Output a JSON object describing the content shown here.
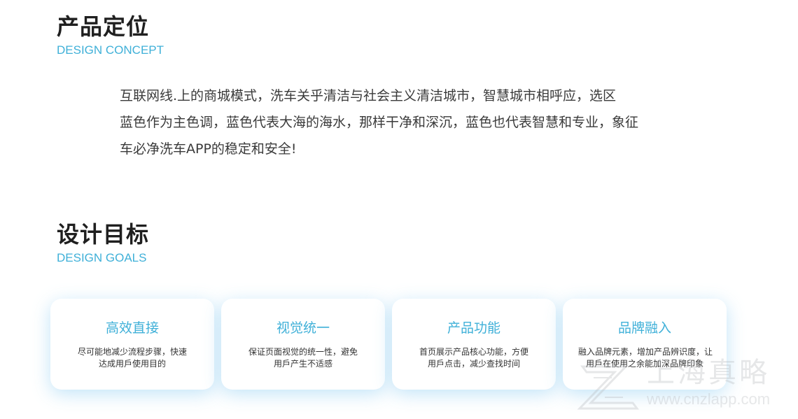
{
  "concept": {
    "title": "产品定位",
    "subtitle": "DESIGN CONCEPT",
    "lines": [
      "互联网线.上的商城模式，洗车关乎清洁与社会主义清洁城市，智慧城市相呼应，选区",
      "蓝色作为主色调，蓝色代表大海的海水，那样干净和深沉，蓝色也代表智慧和专业，象征",
      "车必净洗车APP的稳定和安全!"
    ]
  },
  "goals": {
    "title": "设计目标",
    "subtitle": "DESIGN GOALS",
    "cards": [
      {
        "title": "高效直接",
        "desc": [
          "尽可能地减少流程步骤，快速",
          "达成用戶使用目的"
        ]
      },
      {
        "title": "视觉统一",
        "desc": [
          "保证页面视觉的统一性，避免",
          "用戶产生不适感"
        ]
      },
      {
        "title": "产品功能",
        "desc": [
          "首页展示产品核心功能，方便",
          "用戶点击，减少查找时间"
        ]
      },
      {
        "title": "品牌融入",
        "desc": [
          "融入品牌元素，增加产品辨识度，让",
          "用戶在使用之余能加深品牌印象"
        ]
      }
    ]
  },
  "watermark": {
    "name": "上海真略",
    "url": "www.cnzlapp.com",
    "icon": "zl-logo-icon"
  },
  "colors": {
    "accent": "#3fb0d8",
    "heading": "#1f1f1f",
    "body": "#3a3a3a",
    "card_shadow": "#9fd6f5"
  }
}
